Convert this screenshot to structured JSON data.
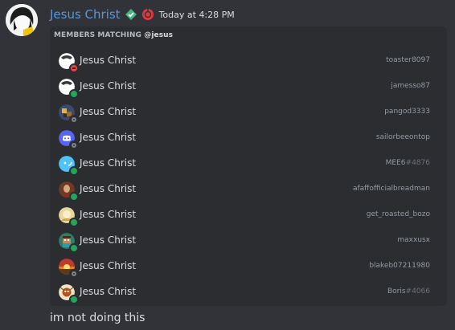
{
  "message": {
    "author": "Jesus Christ",
    "timestamp": "Today at 4:28 PM",
    "text": "im not doing this",
    "author_color": "#5b97d6"
  },
  "embed": {
    "title_prefix": "MEMBERS MATCHING",
    "query": "@jesus",
    "members": [
      {
        "name": "Jesus Christ",
        "handle": "toaster8097",
        "discriminator": "",
        "status": "dnd",
        "avatar_icon": "white-avatar-icon"
      },
      {
        "name": "Jesus Christ",
        "handle": "jamesso87",
        "discriminator": "",
        "status": "online",
        "avatar_icon": "white-avatar-icon"
      },
      {
        "name": "Jesus Christ",
        "handle": "pangod3333",
        "discriminator": "",
        "status": "offline",
        "avatar_icon": "pixel-avatar-icon"
      },
      {
        "name": "Jesus Christ",
        "handle": "sailorbeeontop",
        "discriminator": "",
        "status": "offline",
        "avatar_icon": "discord-default-avatar-icon"
      },
      {
        "name": "Jesus Christ",
        "handle": "MEE6",
        "discriminator": "#4876",
        "status": "online",
        "avatar_icon": "mee6-avatar-icon"
      },
      {
        "name": "Jesus Christ",
        "handle": "afaffofficialbreadman",
        "discriminator": "",
        "status": "online",
        "avatar_icon": "painting-avatar-icon"
      },
      {
        "name": "Jesus Christ",
        "handle": "get_roasted_bozo",
        "discriminator": "",
        "status": "online",
        "avatar_icon": "yellow-avatar-icon"
      },
      {
        "name": "Jesus Christ",
        "handle": "maxxusx",
        "discriminator": "",
        "status": "online",
        "avatar_icon": "minecraft-avatar-icon"
      },
      {
        "name": "Jesus Christ",
        "handle": "blakeb07211980",
        "discriminator": "",
        "status": "offline",
        "avatar_icon": "sunset-avatar-icon"
      },
      {
        "name": "Jesus Christ",
        "handle": "Boris",
        "discriminator": "#4066",
        "status": "online",
        "avatar_icon": "cartoon-avatar-icon"
      }
    ]
  },
  "colors": {
    "background": "#313338",
    "embed_background": "#2b2d31",
    "online": "#23a55a",
    "dnd": "#f23f43",
    "offline": "#80848e"
  }
}
